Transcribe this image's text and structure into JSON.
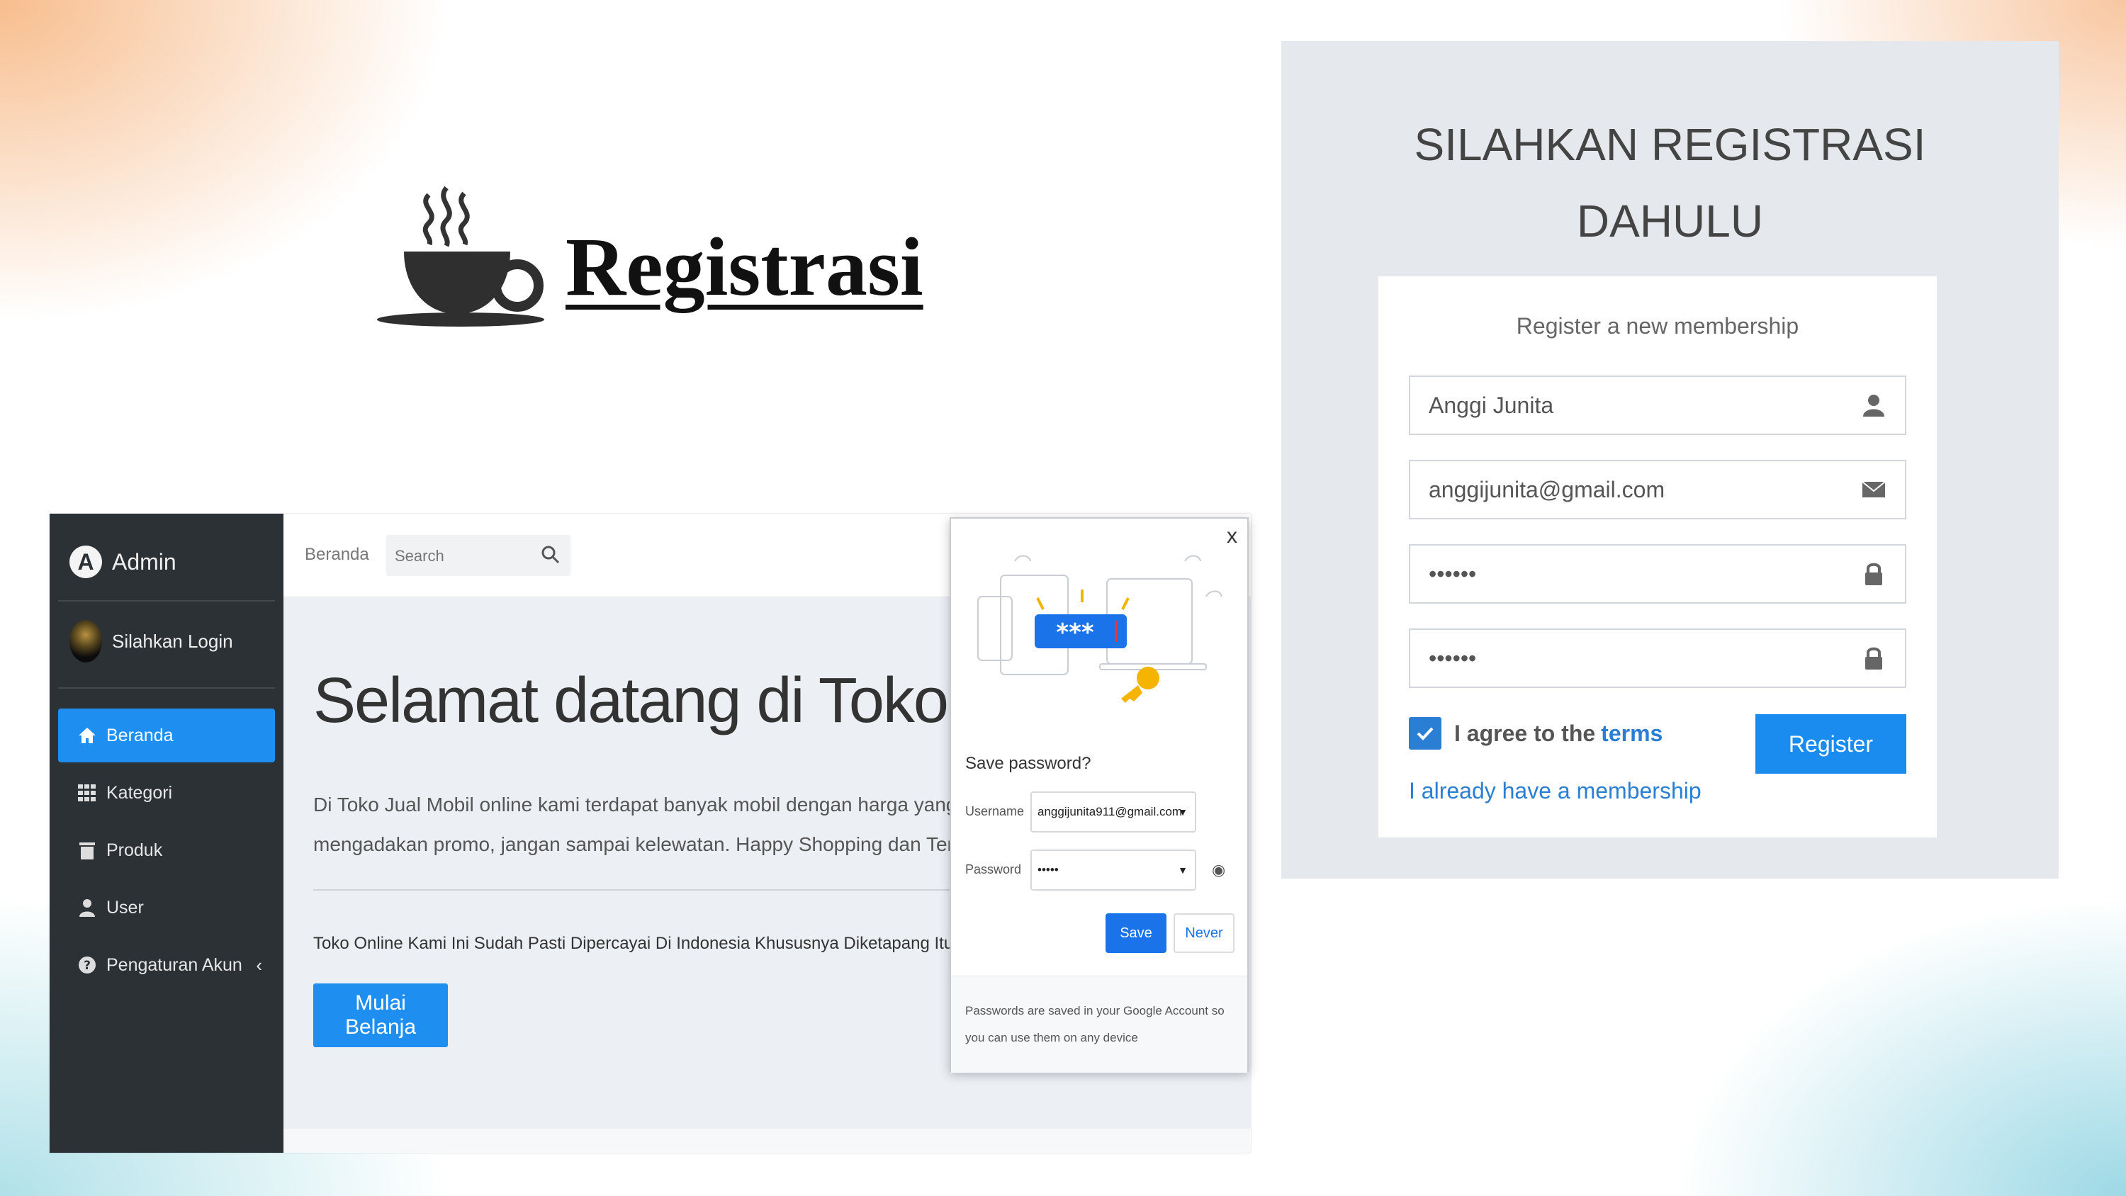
{
  "slide": {
    "title": "Registrasi",
    "icon": "coffee-cup-icon"
  },
  "admin": {
    "brand": "Admin",
    "user_label": "Silahkan Login",
    "menu": [
      {
        "label": "Beranda",
        "icon": "home-icon",
        "active": true
      },
      {
        "label": "Kategori",
        "icon": "grid-icon",
        "active": false
      },
      {
        "label": "Produk",
        "icon": "trash-icon",
        "active": false
      },
      {
        "label": "User",
        "icon": "user-icon",
        "active": false
      },
      {
        "label": "Pengaturan Akun",
        "icon": "help-circle-icon",
        "active": false
      }
    ],
    "breadcrumb": "Beranda",
    "search_placeholder": "Search",
    "welcome_heading": "Selamat datang di Toko Jual M",
    "description_line1": "Di Toko Jual Mobil online kami terdapat banyak mobil dengan harga yang bervariasi d",
    "description_line2": "mengadakan promo, jangan sampai kelewatan. Happy Shopping dan Terimaksih Tela",
    "trust_text": "Toko Online Kami Ini Sudah Pasti Dipercayai Di Indonesia Khususnya Diketapang Itu Sendiri.",
    "cta_label": "Mulai Belanja",
    "accent_color": "#1f8ef1"
  },
  "save_password_popup": {
    "close_label": "x",
    "title": "Save password?",
    "username_label": "Username",
    "username_value": "anggijunita911@gmail.com",
    "password_label": "Password",
    "password_value": "•••••",
    "save_label": "Save",
    "never_label": "Never",
    "footer_text": "Passwords are saved in your Google Account so you can use them on any device",
    "illustration_text": "***"
  },
  "register": {
    "title_line1": "SILAHKAN REGISTRASI",
    "title_line2": "DAHULU",
    "subtitle": "Register a new membership",
    "fields": [
      {
        "value": "Anggi Junita",
        "icon": "user-icon"
      },
      {
        "value": "anggijunita@gmail.com",
        "icon": "envelope-icon"
      },
      {
        "value": "••••••",
        "icon": "lock-icon"
      },
      {
        "value": "••••••",
        "icon": "lock-icon"
      }
    ],
    "agree_text": "I agree to the",
    "terms_link": "terms",
    "agree_checked": true,
    "register_label": "Register",
    "login_link": "I already have a membership",
    "accent_color": "#1a8cf0"
  }
}
